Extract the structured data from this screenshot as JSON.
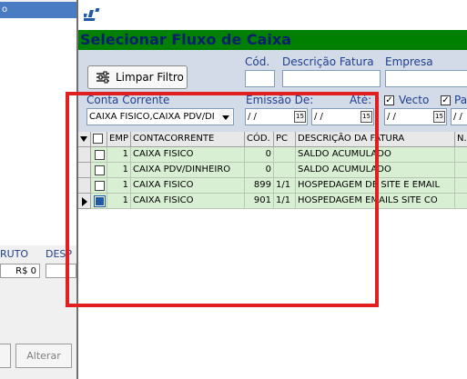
{
  "background_window": {
    "title_fragment": "o",
    "bruto_label": "RUTO",
    "desp_label": "DESP",
    "bruto_value": "R$ 0",
    "alterar_button": "Alterar"
  },
  "dialog": {
    "header": "Selecionar Fluxo de Caixa",
    "limpar_button": "Limpar Filtro",
    "filters": {
      "cod_label": "Cód.",
      "descricao_label": "Descrição Fatura",
      "empresa_label": "Empresa",
      "conta_label": "Conta Corrente",
      "conta_value": "CAIXA FISICO,CAIXA PDV/DI",
      "emissao_label": "Emissão De:",
      "ate_label": "Até:",
      "date_value": "/ /",
      "calendar_glyph": "15",
      "vecto_label": "Vecto",
      "pa_label": "Pa"
    },
    "grid": {
      "columns": [
        "EMP",
        "CONTACORRENTE",
        "CÓD.",
        "PC",
        "DESCRIÇÃO DA FATURA",
        "N."
      ],
      "rows": [
        {
          "emp": "1",
          "conta": "CAIXA FISICO",
          "cod": "0",
          "pc": "",
          "descricao": "SALDO ACUMULADO",
          "selected": false,
          "current": false
        },
        {
          "emp": "1",
          "conta": "CAIXA PDV/DINHEIRO",
          "cod": "0",
          "pc": "",
          "descricao": "SALDO ACUMULADO",
          "selected": false,
          "current": false
        },
        {
          "emp": "1",
          "conta": "CAIXA FISICO",
          "cod": "899",
          "pc": "1/1",
          "descricao": "HOSPEDAGEM DE SITE E EMAIL",
          "selected": false,
          "current": false
        },
        {
          "emp": "1",
          "conta": "CAIXA FISICO",
          "cod": "901",
          "pc": "1/1",
          "descricao": "HOSPEDAGEM EMAILS SITE CO",
          "selected": true,
          "current": true
        }
      ]
    }
  },
  "colors": {
    "header_bg": "#008000",
    "header_text": "#0a1f6e",
    "row_bg": "#d9efd3",
    "highlight": "#e02020",
    "label": "#1f3f8f"
  }
}
